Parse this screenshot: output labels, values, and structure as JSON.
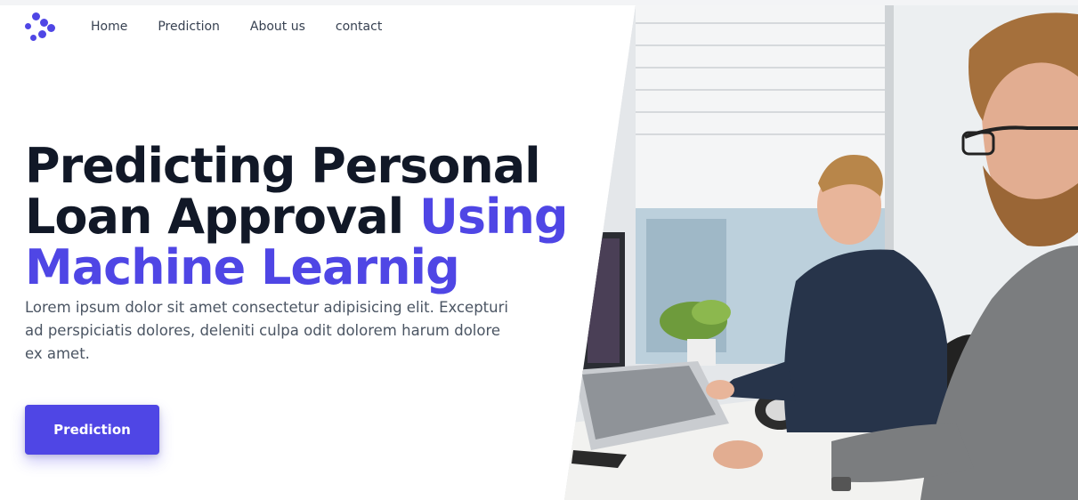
{
  "nav": {
    "logo": "logo-icon",
    "links": [
      "Home",
      "Prediction",
      "About us",
      "contact"
    ]
  },
  "hero": {
    "title_part1": "Predicting Personal Loan Approval ",
    "title_accent": "Using Machine Learnig",
    "text": "Lorem ipsum dolor sit amet consectetur adipisicing elit. Excepturi ad perspiciatis dolores, deleniti culpa odit dolorem harum dolore ex amet.",
    "button_label": "Prediction"
  },
  "photo": {
    "icon": "office-photo"
  },
  "colors": {
    "accent": "#4f46e5",
    "heading": "#111827",
    "body": "#4b5563"
  }
}
